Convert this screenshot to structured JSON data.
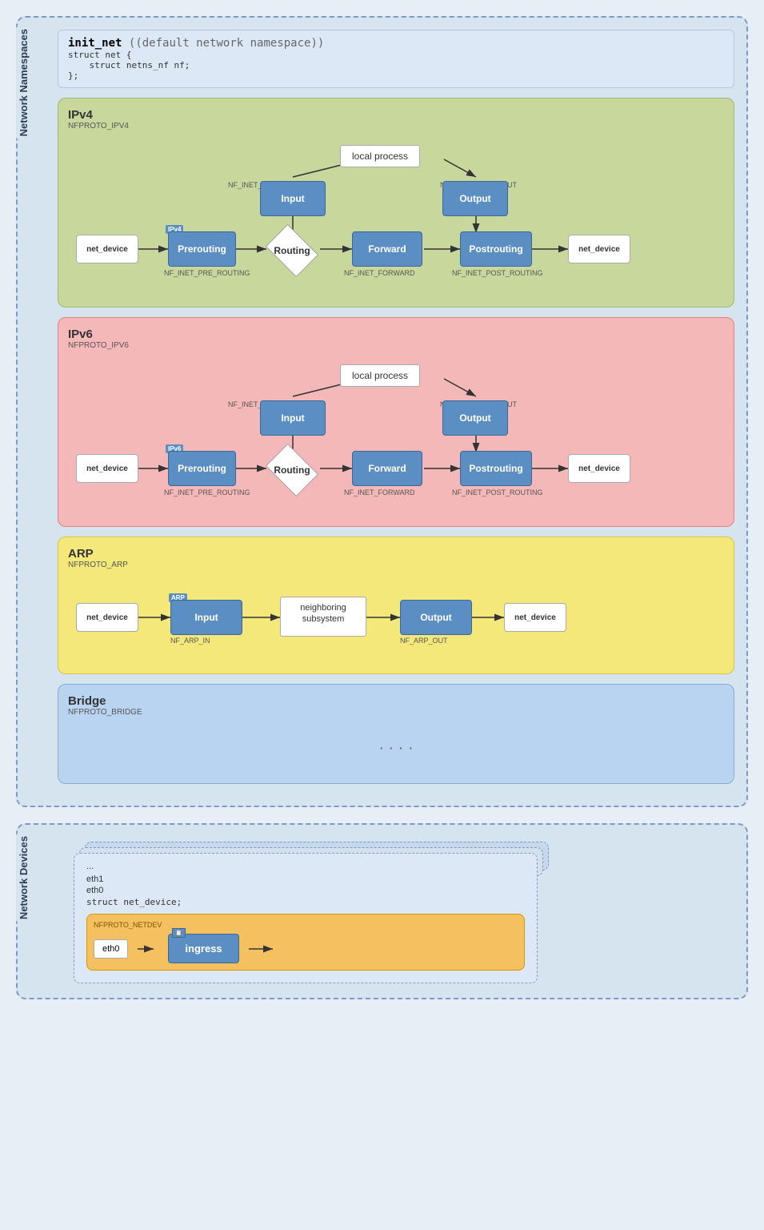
{
  "networkNamespaces": {
    "label": "Network\nNamespaces",
    "initNet": {
      "title": "init_net",
      "subtitle": "(default network namespace)",
      "code": "struct net {\n    struct netns_nf nf;\n};"
    }
  },
  "ipv4": {
    "title": "IPv4",
    "subtitle": "NFPROTO_IPV4",
    "badge": "IPv4",
    "localProcess": "local process",
    "nodes": {
      "netDevice1": "net_device",
      "prerouting": "Prerouting",
      "routing": "Routing",
      "forward": "Forward",
      "postrouting": "Postrouting",
      "input": "Input",
      "output": "Output",
      "netDevice2": "net_device"
    },
    "labels": {
      "preRouting": "NF_INET_PRE_ROUTING",
      "localIn": "NF_INET_LOCAL_IN",
      "localOut": "NF_INET_LOCAL_OUT",
      "forward": "NF_INET_FORWARD",
      "postRouting": "NF_INET_POST_ROUTING"
    }
  },
  "ipv6": {
    "title": "IPv6",
    "subtitle": "NFPROTO_IPV6",
    "badge": "IPv6",
    "localProcess": "local process",
    "nodes": {
      "netDevice1": "net_device",
      "prerouting": "Prerouting",
      "routing": "Routing",
      "forward": "Forward",
      "postrouting": "Postrouting",
      "input": "Input",
      "output": "Output",
      "netDevice2": "net_device"
    },
    "labels": {
      "preRouting": "NF_INET_PRE_ROUTING",
      "localIn": "NF_INET_LOCAL_IN",
      "localOut": "NF_INET_LOCAL_OUT",
      "forward": "NF_INET_FORWARD",
      "postRouting": "NF_INET_POST_ROUTING"
    }
  },
  "arp": {
    "title": "ARP",
    "subtitle": "NFPROTO_ARP",
    "badge": "ARP",
    "nodes": {
      "netDevice1": "net_device",
      "input": "Input",
      "neighboring": "neighboring\nsubsystem",
      "output": "Output",
      "netDevice2": "net_device"
    },
    "labels": {
      "arpIn": "NF_ARP_IN",
      "arpOut": "NF_ARP_OUT"
    }
  },
  "bridge": {
    "title": "Bridge",
    "subtitle": "NFPROTO_BRIDGE",
    "dots": "· · · ·"
  },
  "networkDevices": {
    "label": "Network\nDevices",
    "eth1": "eth1",
    "eth0_label": "eth0",
    "struct": "struct net_device;",
    "nfprotoNetdev": "NFPROTO_NETDEV",
    "eth0": "eth0",
    "ingress": "ingress"
  }
}
